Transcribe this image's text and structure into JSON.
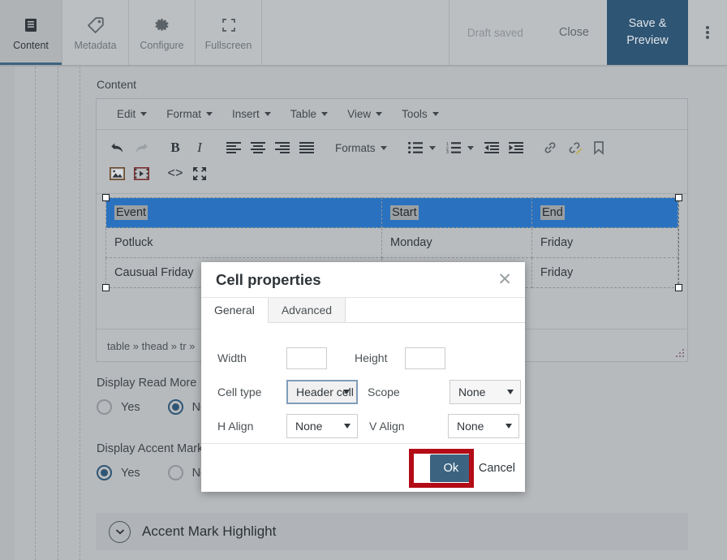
{
  "topbar": {
    "tabs": [
      {
        "label": "Content",
        "icon": "document-lines-icon",
        "active": true
      },
      {
        "label": "Metadata",
        "icon": "tag-icon",
        "active": false
      },
      {
        "label": "Configure",
        "icon": "gear-icon",
        "active": false
      },
      {
        "label": "Fullscreen",
        "icon": "fullscreen-icon",
        "active": false
      }
    ],
    "draft_status": "Draft saved",
    "close_label": "Close",
    "save_preview_label": "Save &\nPreview",
    "save_preview_line1": "Save &",
    "save_preview_line2": "Preview",
    "kebab_icon": "more-vertical-icon",
    "accent_color": "#2f5575",
    "bar_color": "#bcbfc2"
  },
  "page": {
    "content_label": "Content"
  },
  "editor": {
    "menus": [
      {
        "label": "Edit"
      },
      {
        "label": "Format"
      },
      {
        "label": "Insert"
      },
      {
        "label": "Table"
      },
      {
        "label": "View"
      },
      {
        "label": "Tools"
      }
    ],
    "toolbar_row1": [
      {
        "name": "undo-icon",
        "title": "Undo",
        "disabled": false
      },
      {
        "name": "redo-icon",
        "title": "Redo",
        "disabled": true
      },
      {
        "name": "bold-icon",
        "title": "Bold",
        "disabled": false
      },
      {
        "name": "italic-icon",
        "title": "Italic",
        "disabled": false
      },
      {
        "name": "align-left-icon",
        "title": "Align left",
        "disabled": false
      },
      {
        "name": "align-center-icon",
        "title": "Align center",
        "disabled": false
      },
      {
        "name": "align-right-icon",
        "title": "Align right",
        "disabled": false
      },
      {
        "name": "align-justify-icon",
        "title": "Justify",
        "disabled": false
      }
    ],
    "formats_label": "Formats",
    "toolbar_row1b": [
      {
        "name": "bullet-list-icon",
        "title": "Bullet list"
      },
      {
        "name": "numbered-list-icon",
        "title": "Numbered list"
      },
      {
        "name": "outdent-icon",
        "title": "Decrease indent"
      },
      {
        "name": "indent-icon",
        "title": "Increase indent"
      },
      {
        "name": "link-icon",
        "title": "Insert link"
      },
      {
        "name": "unlink-icon",
        "title": "Remove link"
      },
      {
        "name": "anchor-icon",
        "title": "Anchor"
      }
    ],
    "toolbar_row2": [
      {
        "name": "image-icon",
        "title": "Insert image"
      },
      {
        "name": "media-icon",
        "title": "Insert media"
      },
      {
        "name": "source-code-icon",
        "title": "Source code"
      },
      {
        "name": "fullscreen-icon",
        "title": "Fullscreen"
      }
    ],
    "table": {
      "headers": [
        "Event",
        "Start",
        "End"
      ],
      "rows": [
        [
          "Potluck",
          "Monday",
          "Friday"
        ],
        [
          "Causual Friday",
          "",
          "Friday"
        ]
      ]
    },
    "statusbar_path": "table » thead » tr »",
    "resize_grip_icon": "resize-grip-icon"
  },
  "fields": [
    {
      "label": "Display Read More",
      "options": [
        {
          "label": "Yes",
          "selected": false
        },
        {
          "label": "No",
          "selected": true
        }
      ]
    },
    {
      "label": "Display Accent Mark",
      "options": [
        {
          "label": "Yes",
          "selected": true
        },
        {
          "label": "No",
          "selected": false
        }
      ]
    }
  ],
  "accordion": {
    "title": "Accent Mark Highlight",
    "icon": "chevron-down-circle-icon"
  },
  "dialog": {
    "title": "Cell properties",
    "close_icon": "close-icon",
    "tabs": [
      {
        "label": "General",
        "active": true
      },
      {
        "label": "Advanced",
        "active": false
      }
    ],
    "form": {
      "width_label": "Width",
      "width_value": "",
      "width_placeholder": "",
      "height_label": "Height",
      "height_value": "",
      "height_placeholder": "",
      "cell_type_label": "Cell type",
      "cell_type_value": "Header cell",
      "scope_label": "Scope",
      "scope_value": "None",
      "h_align_label": "H Align",
      "h_align_value": "None",
      "v_align_label": "V Align",
      "v_align_value": "None"
    },
    "ok_label": "Ok",
    "cancel_label": "Cancel",
    "highlight_color": "#b30c16"
  }
}
